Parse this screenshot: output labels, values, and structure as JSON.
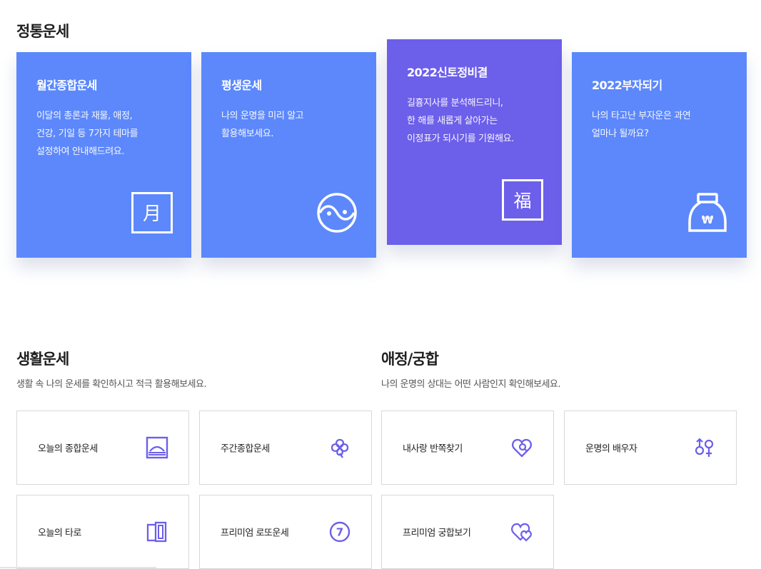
{
  "sections": {
    "main": {
      "title": "정통운세"
    },
    "life": {
      "title": "생활운세",
      "subtitle": "생활 속 나의 운세를 확인하시고 적극 활용해보세요."
    },
    "love": {
      "title": "애정/궁합",
      "subtitle": "나의 운명의 상대는 어떤 사람인지 확인해보세요."
    }
  },
  "cards": [
    {
      "title": "월간종합운세",
      "desc": "이달의 총론과 재물, 애정,\n건강, 기일 등 7가지 테마를\n설정하여 안내해드려요.",
      "icon": "moon-month-icon",
      "icon_char": "月"
    },
    {
      "title": "평생운세",
      "desc": "나의 운명을 미리 알고\n활용해보세요.",
      "icon": "yin-yang-icon"
    },
    {
      "title": "2022신토정비결",
      "desc": "길흉지사를 분석해드리니,\n한 해를 새롭게 살아가는\n이정표가 되시기를 기원해요.",
      "icon": "fortune-bok-icon",
      "icon_char": "福"
    },
    {
      "title": "2022부자되기",
      "desc": "나의 타고난 부자운은 과연\n얼마나 될까요?",
      "icon": "money-bag-icon",
      "icon_char": "₩"
    }
  ],
  "life_items": [
    {
      "label": "오늘의 종합운세",
      "icon": "sunrise-icon"
    },
    {
      "label": "주간종합운세",
      "icon": "clover-icon"
    },
    {
      "label": "오늘의 타로",
      "icon": "tarot-cards-icon"
    },
    {
      "label": "프리미엄 로또운세",
      "icon": "lucky-seven-icon",
      "icon_char": "7"
    }
  ],
  "love_items": [
    {
      "label": "내사랑 반쪽찾기",
      "icon": "heart-search-icon"
    },
    {
      "label": "운명의 배우자",
      "icon": "gender-symbols-icon"
    },
    {
      "label": "프리미엄 궁합보기",
      "icon": "double-heart-icon"
    }
  ],
  "colors": {
    "card_blue": "#5c88fb",
    "card_purple": "#6c5fea",
    "icon_purple": "#6c5fea"
  }
}
